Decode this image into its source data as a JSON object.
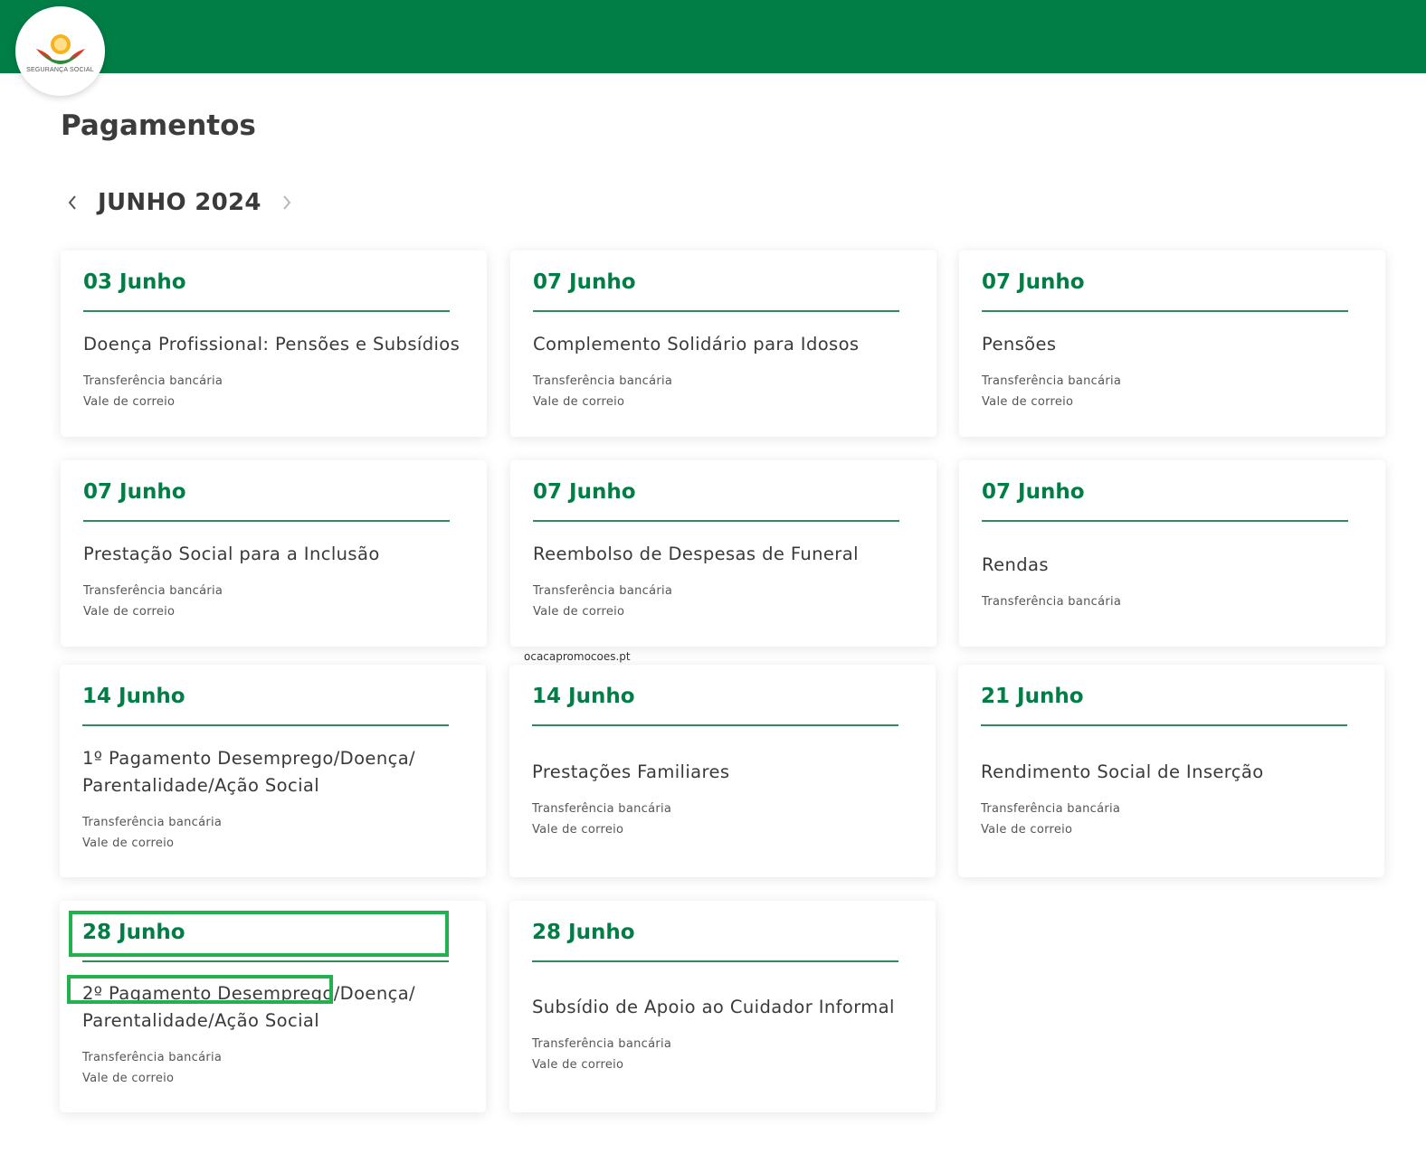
{
  "header": {
    "logo_text": "SEGURANÇA SOCIAL",
    "brand_color": "#007e45"
  },
  "page": {
    "title": "Pagamentos"
  },
  "month_nav": {
    "label": "JUNHO 2024",
    "prev_icon": "chevron-left-icon",
    "next_icon": "chevron-right-icon"
  },
  "watermark": "ocacapromocoes.pt",
  "cards": [
    {
      "date": "03 Junho",
      "title": "Doença Profissional: Pensões e Subsídios",
      "methods": [
        "Transferência bancária",
        "Vale de correio"
      ]
    },
    {
      "date": "07 Junho",
      "title": "Complemento Solidário para Idosos",
      "methods": [
        "Transferência bancária",
        "Vale de correio"
      ]
    },
    {
      "date": "07 Junho",
      "title": "Pensões",
      "methods": [
        "Transferência bancária",
        "Vale de correio"
      ]
    },
    {
      "date": "07 Junho",
      "title": "Prestação Social para a Inclusão",
      "methods": [
        "Transferência bancária",
        "Vale de correio"
      ]
    },
    {
      "date": "07 Junho",
      "title": "Reembolso de Despesas de Funeral",
      "methods": [
        "Transferência bancária",
        "Vale de correio"
      ]
    },
    {
      "date": "07 Junho",
      "title": "Rendas",
      "methods": [
        "Transferência bancária"
      ]
    },
    {
      "date": "14 Junho",
      "title": "1º Pagamento Desemprego/Doença/ Parentalidade/Ação Social",
      "methods": [
        "Transferência bancária",
        "Vale de correio"
      ]
    },
    {
      "date": "14 Junho",
      "title": "Prestações Familiares",
      "methods": [
        "Transferência bancária",
        "Vale de correio"
      ]
    },
    {
      "date": "21 Junho",
      "title": "Rendimento Social de Inserção",
      "methods": [
        "Transferência bancária",
        "Vale de correio"
      ]
    },
    {
      "date": "28 Junho",
      "title": "2º Pagamento Desemprego/Doença/ Parentalidade/Ação Social",
      "methods": [
        "Transferência bancária",
        "Vale de correio"
      ]
    },
    {
      "date": "28 Junho",
      "title": "Subsídio de Apoio ao Cuidador Informal",
      "methods": [
        "Transferência bancária",
        "Vale de correio"
      ]
    }
  ],
  "highlight_color": "#22b14c"
}
